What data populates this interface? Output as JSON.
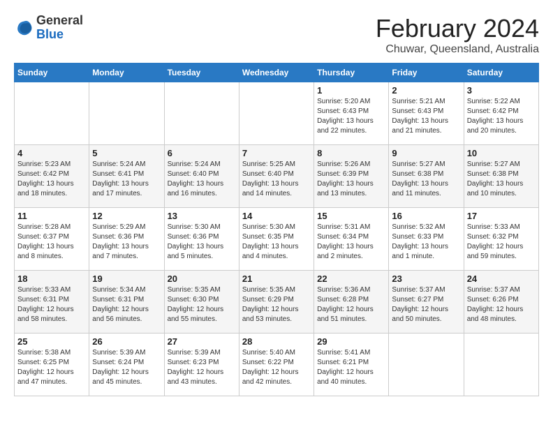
{
  "logo": {
    "general": "General",
    "blue": "Blue"
  },
  "header": {
    "month": "February 2024",
    "location": "Chuwar, Queensland, Australia"
  },
  "weekdays": [
    "Sunday",
    "Monday",
    "Tuesday",
    "Wednesday",
    "Thursday",
    "Friday",
    "Saturday"
  ],
  "weeks": [
    [
      {
        "day": "",
        "info": ""
      },
      {
        "day": "",
        "info": ""
      },
      {
        "day": "",
        "info": ""
      },
      {
        "day": "",
        "info": ""
      },
      {
        "day": "1",
        "info": "Sunrise: 5:20 AM\nSunset: 6:43 PM\nDaylight: 13 hours\nand 22 minutes."
      },
      {
        "day": "2",
        "info": "Sunrise: 5:21 AM\nSunset: 6:43 PM\nDaylight: 13 hours\nand 21 minutes."
      },
      {
        "day": "3",
        "info": "Sunrise: 5:22 AM\nSunset: 6:42 PM\nDaylight: 13 hours\nand 20 minutes."
      }
    ],
    [
      {
        "day": "4",
        "info": "Sunrise: 5:23 AM\nSunset: 6:42 PM\nDaylight: 13 hours\nand 18 minutes."
      },
      {
        "day": "5",
        "info": "Sunrise: 5:24 AM\nSunset: 6:41 PM\nDaylight: 13 hours\nand 17 minutes."
      },
      {
        "day": "6",
        "info": "Sunrise: 5:24 AM\nSunset: 6:40 PM\nDaylight: 13 hours\nand 16 minutes."
      },
      {
        "day": "7",
        "info": "Sunrise: 5:25 AM\nSunset: 6:40 PM\nDaylight: 13 hours\nand 14 minutes."
      },
      {
        "day": "8",
        "info": "Sunrise: 5:26 AM\nSunset: 6:39 PM\nDaylight: 13 hours\nand 13 minutes."
      },
      {
        "day": "9",
        "info": "Sunrise: 5:27 AM\nSunset: 6:38 PM\nDaylight: 13 hours\nand 11 minutes."
      },
      {
        "day": "10",
        "info": "Sunrise: 5:27 AM\nSunset: 6:38 PM\nDaylight: 13 hours\nand 10 minutes."
      }
    ],
    [
      {
        "day": "11",
        "info": "Sunrise: 5:28 AM\nSunset: 6:37 PM\nDaylight: 13 hours\nand 8 minutes."
      },
      {
        "day": "12",
        "info": "Sunrise: 5:29 AM\nSunset: 6:36 PM\nDaylight: 13 hours\nand 7 minutes."
      },
      {
        "day": "13",
        "info": "Sunrise: 5:30 AM\nSunset: 6:36 PM\nDaylight: 13 hours\nand 5 minutes."
      },
      {
        "day": "14",
        "info": "Sunrise: 5:30 AM\nSunset: 6:35 PM\nDaylight: 13 hours\nand 4 minutes."
      },
      {
        "day": "15",
        "info": "Sunrise: 5:31 AM\nSunset: 6:34 PM\nDaylight: 13 hours\nand 2 minutes."
      },
      {
        "day": "16",
        "info": "Sunrise: 5:32 AM\nSunset: 6:33 PM\nDaylight: 13 hours\nand 1 minute."
      },
      {
        "day": "17",
        "info": "Sunrise: 5:33 AM\nSunset: 6:32 PM\nDaylight: 12 hours\nand 59 minutes."
      }
    ],
    [
      {
        "day": "18",
        "info": "Sunrise: 5:33 AM\nSunset: 6:31 PM\nDaylight: 12 hours\nand 58 minutes."
      },
      {
        "day": "19",
        "info": "Sunrise: 5:34 AM\nSunset: 6:31 PM\nDaylight: 12 hours\nand 56 minutes."
      },
      {
        "day": "20",
        "info": "Sunrise: 5:35 AM\nSunset: 6:30 PM\nDaylight: 12 hours\nand 55 minutes."
      },
      {
        "day": "21",
        "info": "Sunrise: 5:35 AM\nSunset: 6:29 PM\nDaylight: 12 hours\nand 53 minutes."
      },
      {
        "day": "22",
        "info": "Sunrise: 5:36 AM\nSunset: 6:28 PM\nDaylight: 12 hours\nand 51 minutes."
      },
      {
        "day": "23",
        "info": "Sunrise: 5:37 AM\nSunset: 6:27 PM\nDaylight: 12 hours\nand 50 minutes."
      },
      {
        "day": "24",
        "info": "Sunrise: 5:37 AM\nSunset: 6:26 PM\nDaylight: 12 hours\nand 48 minutes."
      }
    ],
    [
      {
        "day": "25",
        "info": "Sunrise: 5:38 AM\nSunset: 6:25 PM\nDaylight: 12 hours\nand 47 minutes."
      },
      {
        "day": "26",
        "info": "Sunrise: 5:39 AM\nSunset: 6:24 PM\nDaylight: 12 hours\nand 45 minutes."
      },
      {
        "day": "27",
        "info": "Sunrise: 5:39 AM\nSunset: 6:23 PM\nDaylight: 12 hours\nand 43 minutes."
      },
      {
        "day": "28",
        "info": "Sunrise: 5:40 AM\nSunset: 6:22 PM\nDaylight: 12 hours\nand 42 minutes."
      },
      {
        "day": "29",
        "info": "Sunrise: 5:41 AM\nSunset: 6:21 PM\nDaylight: 12 hours\nand 40 minutes."
      },
      {
        "day": "",
        "info": ""
      },
      {
        "day": "",
        "info": ""
      }
    ]
  ]
}
